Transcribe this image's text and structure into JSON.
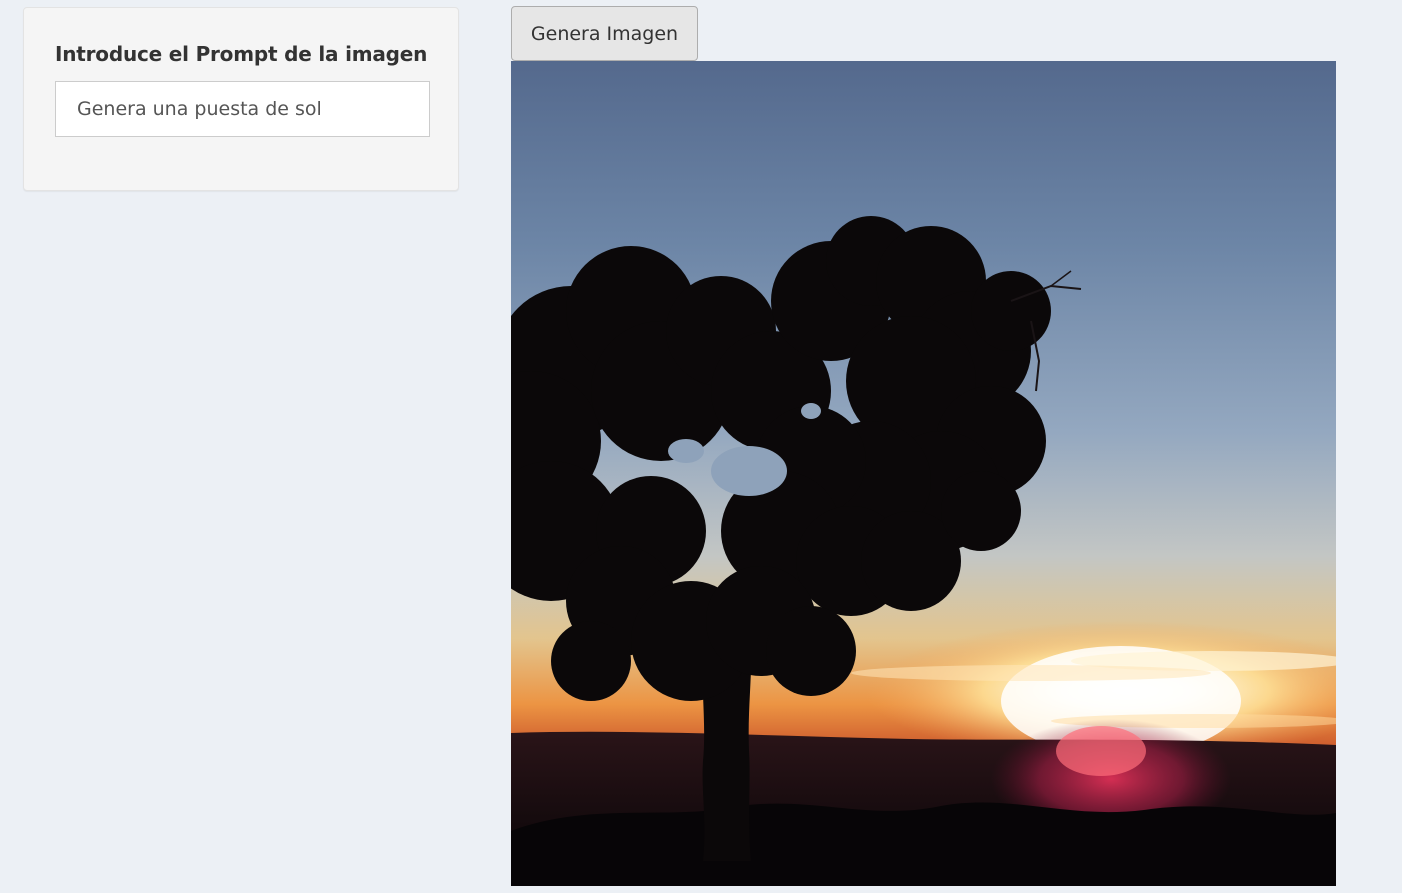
{
  "prompt": {
    "label": "Introduce el Prompt de la imagen",
    "value": "Genera una puesta de sol"
  },
  "generate_button": {
    "label": "Genera Imagen"
  },
  "image": {
    "subject": "sunset-with-tree-silhouette"
  }
}
